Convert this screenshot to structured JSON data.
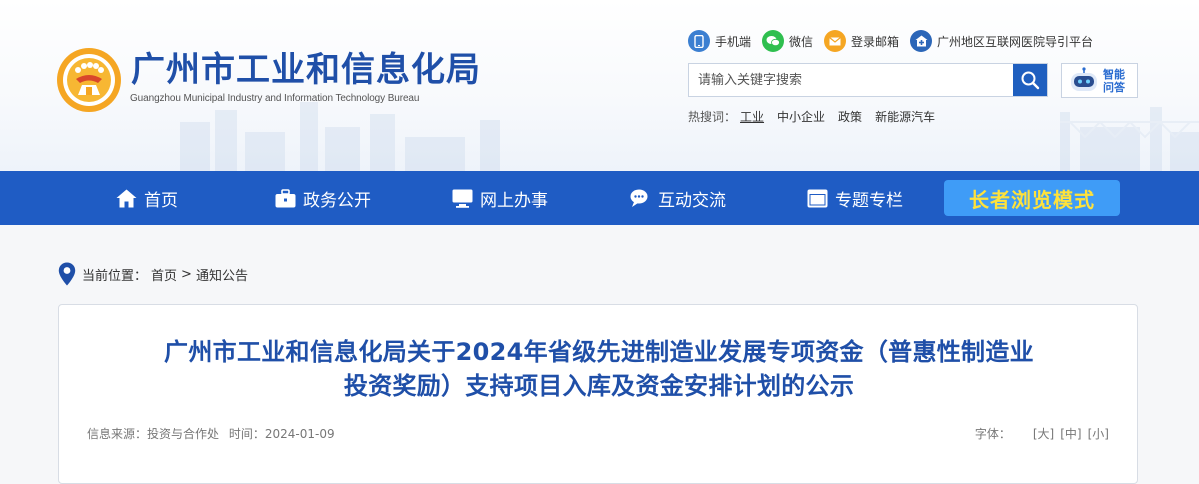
{
  "header": {
    "logo_title": "广州市工业和信息化局",
    "logo_subtitle": "Guangzhou Municipal Industry and Information Technology Bureau",
    "quick_links": [
      {
        "label": "手机端",
        "icon": "phone-icon"
      },
      {
        "label": "微信",
        "icon": "wechat-icon"
      },
      {
        "label": "登录邮箱",
        "icon": "mail-icon"
      },
      {
        "label": "广州地区互联网医院导引平台",
        "icon": "hospital-icon"
      }
    ],
    "search_placeholder": "请输入关键字搜索",
    "ai_label_line1": "智能",
    "ai_label_line2": "问答",
    "hot_label": "热搜词：",
    "hot_words": [
      "工业",
      "中小企业",
      "政策",
      "新能源汽车"
    ]
  },
  "nav": {
    "items": [
      {
        "label": "首页",
        "icon": "home-icon"
      },
      {
        "label": "政务公开",
        "icon": "briefcase-icon"
      },
      {
        "label": "网上办事",
        "icon": "monitor-icon"
      },
      {
        "label": "互动交流",
        "icon": "chat-icon"
      },
      {
        "label": "专题专栏",
        "icon": "window-icon"
      }
    ],
    "elder_mode": "长者浏览模式"
  },
  "breadcrumb": {
    "label": "当前位置：",
    "items": [
      "首页",
      "通知公告"
    ],
    "separator": ">"
  },
  "article": {
    "title_line1": "广州市工业和信息化局关于2024年省级先进制造业发展专项资金（普惠性制造业",
    "title_line2": "投资奖励）支持项目入库及资金安排计划的公示",
    "source": "信息来源：投资与合作处",
    "time": "时间：2024-01-09",
    "font_label": "字体：",
    "font_sizes": [
      "[大]",
      "[中]",
      "[小]"
    ]
  },
  "colors": {
    "brand_blue": "#1f5cc4",
    "title_blue": "#1f4fa8",
    "elder_button": "#3f9cf7",
    "elder_text": "#ffe23b"
  }
}
